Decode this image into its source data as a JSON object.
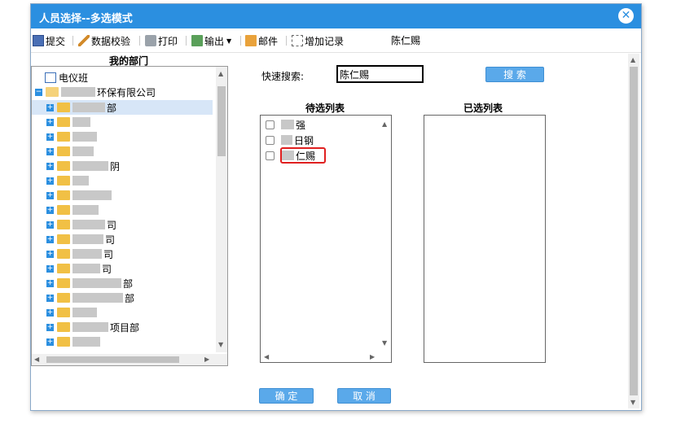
{
  "dialog": {
    "title": "人员选择--多选模式",
    "close_glyph": "✕"
  },
  "toolbar": {
    "items": [
      {
        "label": "提交",
        "icon": "save-icon"
      },
      {
        "label": "数据校验",
        "icon": "wand-icon"
      },
      {
        "label": "打印",
        "icon": "print-icon"
      },
      {
        "label": "输出",
        "icon": "export-icon"
      },
      {
        "label": "邮件",
        "icon": "mail-icon"
      },
      {
        "label": "增加记录",
        "icon": "add-record-icon"
      }
    ],
    "selected_person": "陈仁赐"
  },
  "tree": {
    "title": "我的部门",
    "root_item": "电仪班",
    "company_suffix": "环保有限公司",
    "children": [
      {
        "suffix": "部"
      },
      {
        "suffix": ""
      },
      {
        "suffix": ""
      },
      {
        "suffix": ""
      },
      {
        "suffix": "阴"
      },
      {
        "suffix": ""
      },
      {
        "suffix": ""
      },
      {
        "suffix": ""
      },
      {
        "suffix": "司"
      },
      {
        "suffix": "司"
      },
      {
        "suffix": "司"
      },
      {
        "suffix": "司"
      },
      {
        "suffix": "部"
      },
      {
        "suffix": "部"
      },
      {
        "suffix": ""
      },
      {
        "suffix": "项目部"
      },
      {
        "suffix": ""
      }
    ]
  },
  "search": {
    "label": "快速搜索:",
    "value": "陈仁赐",
    "button": "搜 索"
  },
  "candidate_list": {
    "title": "待选列表",
    "items": [
      "强",
      "日钢",
      "仁赐"
    ]
  },
  "selected_list": {
    "title": "已选列表"
  },
  "footer": {
    "ok": "确 定",
    "cancel": "取 消"
  }
}
